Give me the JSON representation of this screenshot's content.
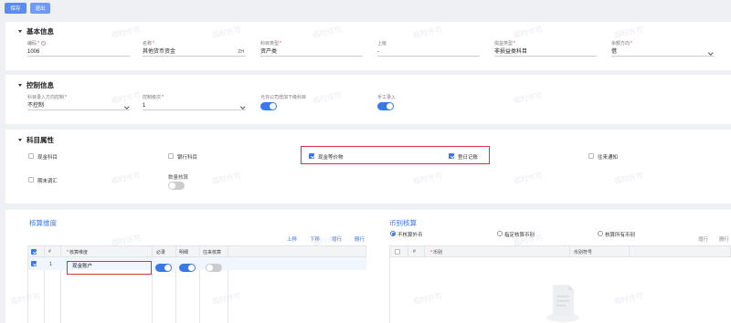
{
  "toolbar": {
    "save_label": "保存",
    "exit_label": "退出"
  },
  "basic": {
    "title": "基本信息",
    "code": {
      "label": "编码",
      "value": "1006"
    },
    "name": {
      "label": "名称",
      "value": "其他货币资金",
      "suffix": "ZH"
    },
    "account_type": {
      "label": "科目类型",
      "value": "资产类"
    },
    "parent": {
      "label": "上级",
      "value": "-"
    },
    "pl_type": {
      "label": "损益类型",
      "value": "非损益类科目"
    },
    "balance_dir": {
      "label": "余额方向",
      "value": "借"
    }
  },
  "control": {
    "title": "控制信息",
    "entry_dir": {
      "label": "科目录入方向控制",
      "value": "不控制"
    },
    "level": {
      "label": "控制级次",
      "value": "1"
    },
    "allow_sub": {
      "label": "允许公司增加下级科目"
    },
    "manual": {
      "label": "手工录入"
    }
  },
  "attrs": {
    "title": "科目属性",
    "cash": "现金科目",
    "bank": "银行科目",
    "cash_eq": "现金等价物",
    "journal": "登日记账",
    "notify": "往来通知",
    "period_adj": "期末调汇",
    "qty_calc": "数量核算"
  },
  "dims": {
    "title": "核算维度",
    "actions": [
      "上移",
      "下移",
      "增行",
      "删行"
    ],
    "headers": {
      "num": "#",
      "dim": "核算维度",
      "required": "必录",
      "detail": "明细",
      "trans": "往来核算"
    },
    "rows": [
      {
        "num": "1",
        "dim": "现金账户"
      }
    ]
  },
  "currency": {
    "title": "币别核算",
    "options": [
      "不核算外币",
      "指定核算币别",
      "核算所有币别"
    ],
    "actions": [
      "增行",
      "删行"
    ],
    "headers": {
      "num": "#",
      "currency": "币别",
      "code": "币别符号"
    }
  },
  "watermark": "临时许可"
}
